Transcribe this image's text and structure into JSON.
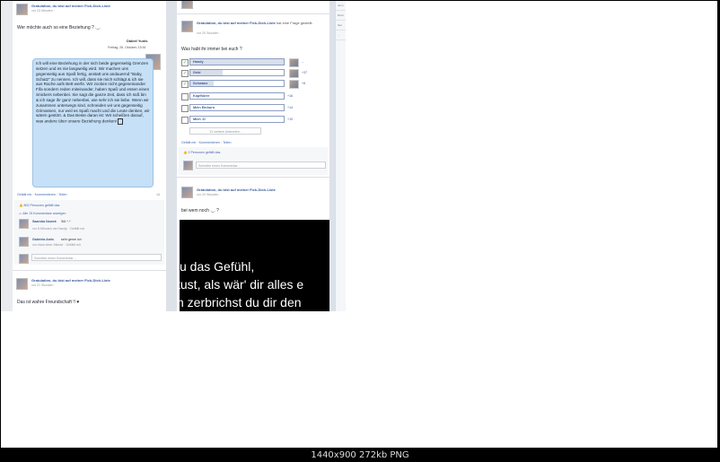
{
  "page_name": "Gratulation, du bist auf meiner Fick-Dich-Liste",
  "caption": "1440x900  272kb  PNG",
  "left": {
    "post1": {
      "time": "vor 23 Minuten · ",
      "text": "Wer möchte auch so eine Beziehung ? ._.",
      "author": "Dakiel Yunis",
      "date": "Freitag, 26. Oktober, 15:51",
      "bubble": "Ich will eine Beziehung in der sich beide gegenseitig Grenzen setzen und es nie langweilig wird. Wir machen uns gegenseitig aus Spaß fertig, anstatt uns andauernd \"Baby, Schatz\" zu nennen. Ich will, dass sie mich schlägt & ich sie aus Rache aufs Bett werfe. Wir zocken nicht gegeneinander Fifa sondern reden miteinander, haben Spaß und essen einen Snickers nebenbei. Sie sagt die ganze Zeit, dass ich süß bin & ich sage ihr ganz nebenbei, wie sehr ich sie liebe. Wenn wir zusammen unterwegs sind, schneiden wir uns gegenseitig Grimassen, nur weil es Spaß macht und die Leute denken, wir wären gestört. & Das Beste daran ist: Wir scheißen darauf, was andere über unsere Beziehung denken! ",
      "actions": "Gefällt mir · Kommentieren · Teilen",
      "share_count": "18",
      "likes": "802 Personen gefällt das.",
      "view_comments": "Alle 15 Kommentare anzeigen",
      "c1_name": "Saandra Nowek",
      "c1_text": "Sül ^.^",
      "c1_meta": "vor 8 Minuten via Handy · Gefällt mir",
      "c2_name": "Gabriela Amis",
      "c2_text": "sehr geme ich",
      "c2_meta": "vor etwa einer Minute · Gefällt mir",
      "comment_placeholder": "Schreibe einen Kommentar ..."
    },
    "post2": {
      "time": "vor 21 Stunden · ",
      "text": "Das ist wahre Freundschaft !! ♥"
    }
  },
  "middle": {
    "post1": {
      "question_suffix": "hat eine Frage gestellt.",
      "time": "vor 20 Stunden · ",
      "question": "Was habt ihr immer bei euch ?",
      "options": [
        {
          "label": "Handy",
          "checked": true,
          "fill": 1.0,
          "count": "..."
        },
        {
          "label": "Geld",
          "checked": true,
          "fill": 0.35,
          "count": "+37"
        },
        {
          "label": "Schwanz",
          "checked": true,
          "fill": 0.25,
          "count": "+8"
        },
        {
          "label": "Kopfhörer",
          "checked": false,
          "fill": 0.0,
          "count": "+16"
        },
        {
          "label": "Mein Einhorn",
          "checked": false,
          "fill": 0.0,
          "count": "+14"
        },
        {
          "label": "Mich :D",
          "checked": false,
          "fill": 0.0,
          "count": "+10"
        }
      ],
      "more_options": "13 weitere Antworten ...",
      "actions": "Gefällt mir · Kommentieren · Teilen",
      "likes": "2 Personen gefällt das.",
      "comment_placeholder": "Schreibe einen Kommentar ..."
    },
    "post2": {
      "time": "vor 20 Stunden · ",
      "text": "bei wem noch ._. ?",
      "video_lines": [
        "u das Gefühl,",
        "tust, als wär' dir alles e",
        "n zerbrichst du dir den"
      ]
    },
    "top_fragments": [
      "hat eine Frage",
      "gestellt."
    ]
  },
  "right_strip": [
    "Jerm",
    "Dicot",
    "Sec",
    "..."
  ]
}
